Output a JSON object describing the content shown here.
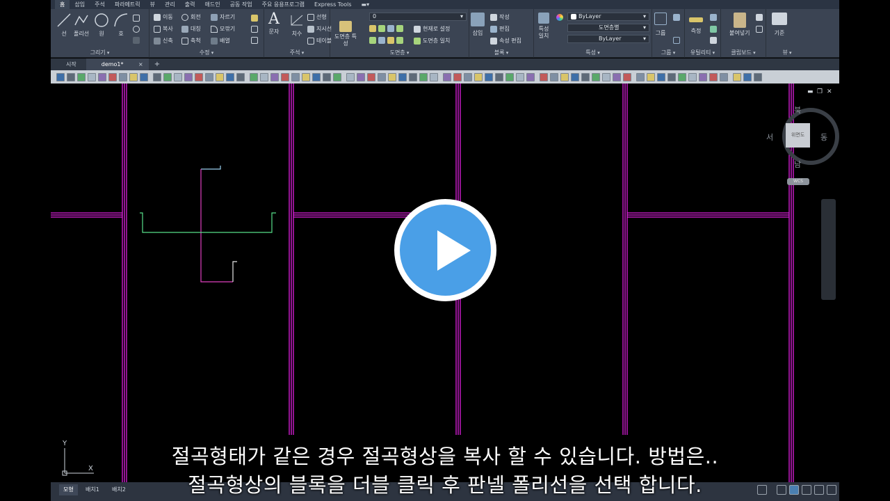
{
  "ribbon_tabs": [
    "홈",
    "삽입",
    "주석",
    "파라메트릭",
    "뷰",
    "관리",
    "출력",
    "애드인",
    "공동 작업",
    "주요 응용프로그램",
    "Express Tools",
    "▬▾"
  ],
  "panels": {
    "draw": {
      "title": "그리기",
      "tools": [
        "선",
        "폴리선",
        "원",
        "호"
      ]
    },
    "modify": {
      "title": "수정",
      "tools": [
        "이동",
        "회전",
        "자르기",
        "복사",
        "대칭",
        "모깎기",
        "신축",
        "축척",
        "배열"
      ]
    },
    "annotation": {
      "title": "주석",
      "tools": [
        "문자",
        "치수",
        "선형",
        "지시선",
        "테이블"
      ]
    },
    "layers": {
      "title": "도면층",
      "big": "도면층 특성",
      "tools": [
        "현재로 설정",
        "도면층 일치"
      ],
      "layer_value": "0"
    },
    "block": {
      "title": "블록",
      "big": "삽입",
      "tools": [
        "작성",
        "편집",
        "속성 편집"
      ]
    },
    "properties": {
      "title": "특성",
      "big": "특성 일치",
      "color": "ByLayer",
      "linetype": "도면층별",
      "lineweight": "ByLayer"
    },
    "groups": {
      "title": "그룹",
      "big": "그룹"
    },
    "utilities": {
      "title": "유틸리티",
      "big": "측정"
    },
    "clipboard": {
      "title": "클립보드",
      "big": "붙여넣기"
    },
    "view": {
      "title": "뷰",
      "big": "기준"
    }
  },
  "doc_tabs": {
    "start": "시작",
    "active": "demo1*",
    "close": "×",
    "new": "+"
  },
  "viewcube": {
    "face": "위면도",
    "north": "북",
    "south": "남",
    "east": "동",
    "west": "서",
    "wcs": "WCS"
  },
  "ucs": {
    "x": "X",
    "y": "Y"
  },
  "window_controls": {
    "minimize": "▬",
    "restore": "❐",
    "close": "✕"
  },
  "layout_tabs": [
    "모형",
    "배치1",
    "배치2"
  ],
  "subtitles": {
    "line1": "절곡형태가 같은 경우 절곡형상을 복사 할 수 있습니다. 방법은..",
    "line2": "절곡형상의 블록을 더블 클릭 후 판넬 폴리선을 선택 합니다."
  },
  "colors": {
    "ribbon_bg": "#3b4453",
    "magenta_walls": "#e020e0",
    "panel_green": "#57e08a",
    "panel_cyan": "#7fb6e6",
    "play_blue": "#4a9fe7"
  }
}
